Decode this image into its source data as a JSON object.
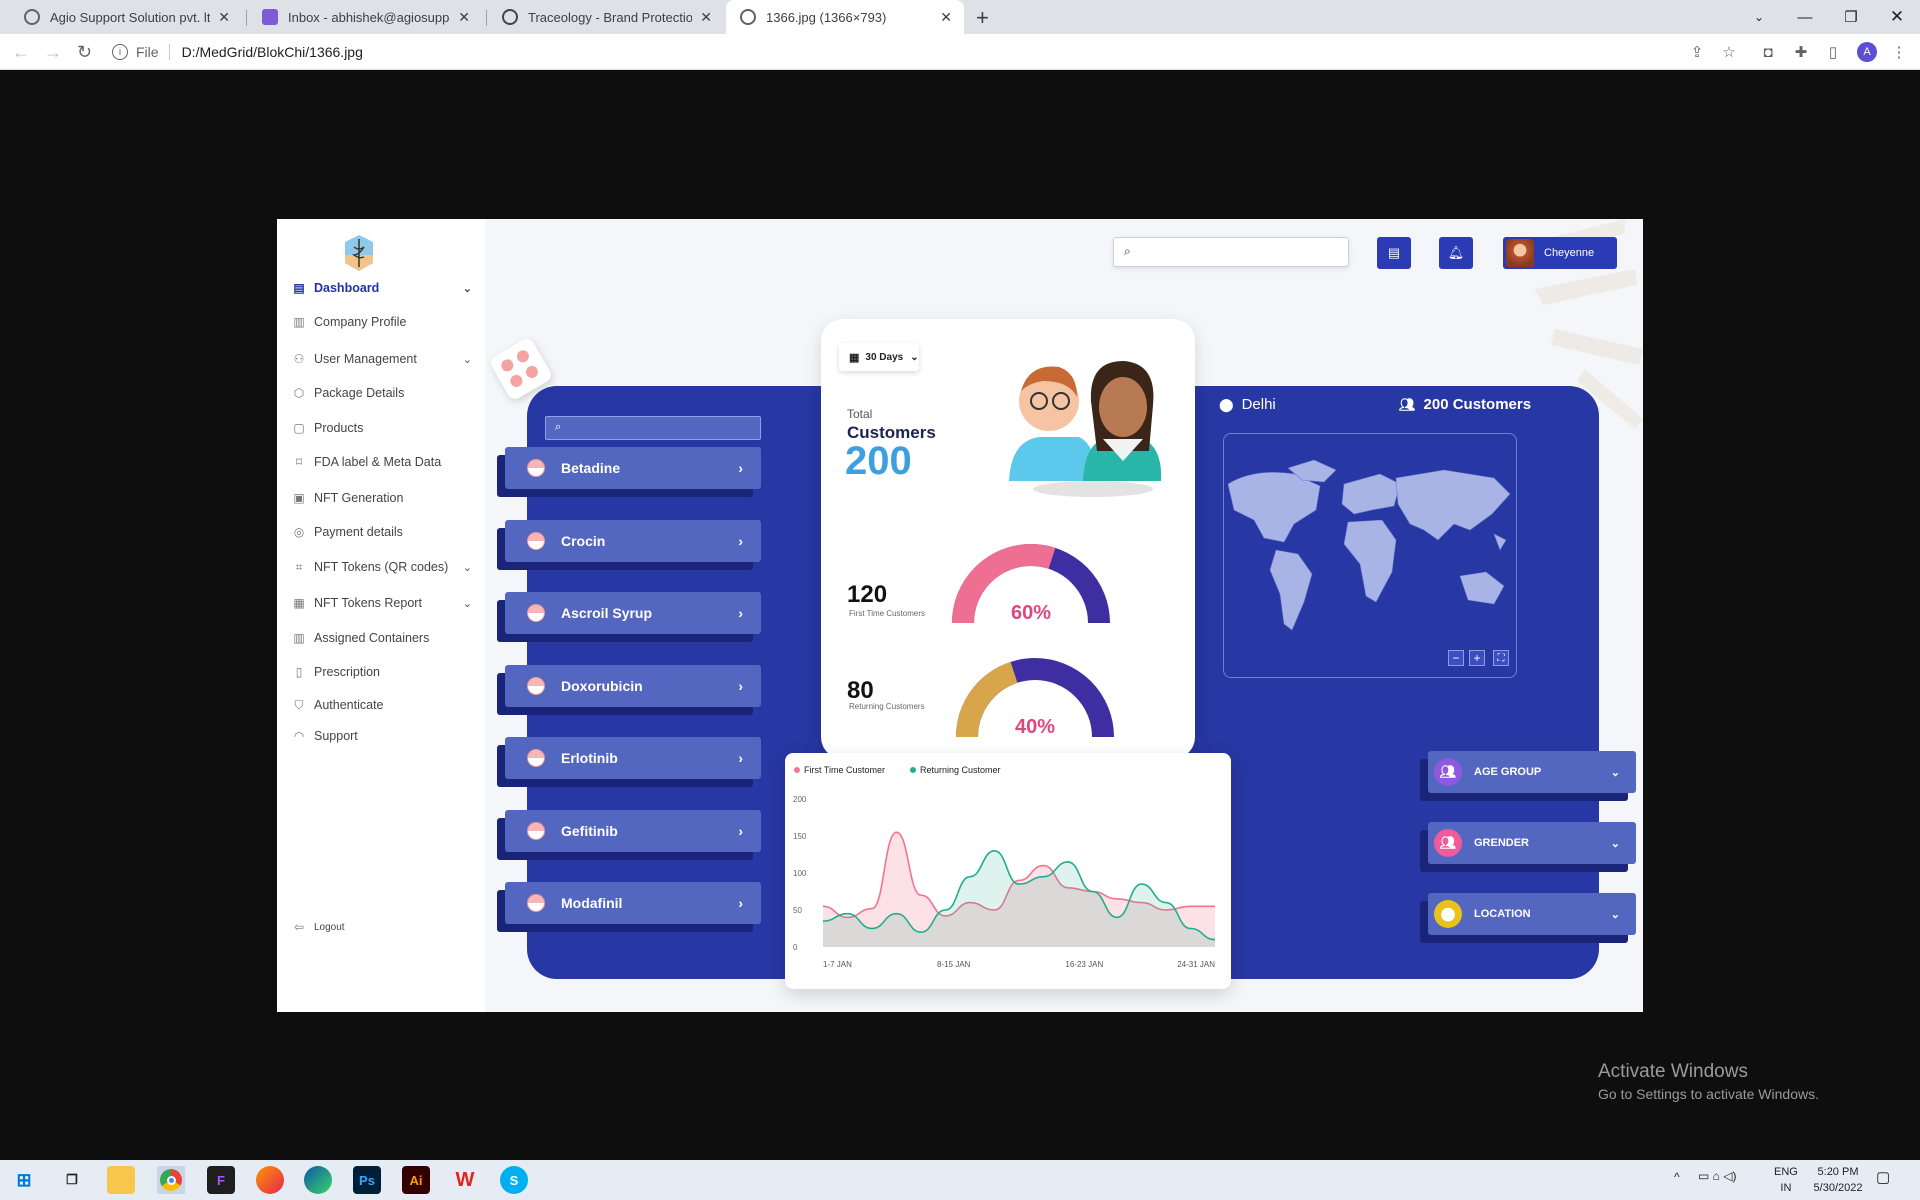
{
  "browser": {
    "tabs": [
      {
        "title": "Agio Support Solution pvt. ltd.",
        "color": "#5f6368"
      },
      {
        "title": "Inbox - abhishek@agiosupport.in",
        "color": "#7b5cd6"
      },
      {
        "title": "Traceology - Brand Protection - D",
        "color": "#444"
      },
      {
        "title": "1366.jpg (1366×793)",
        "color": "#5f6368"
      }
    ],
    "new_tab": "+",
    "url_prefix": "File",
    "url": "D:/MedGrid/BlokChi/1366.jpg",
    "profile_initial": "A"
  },
  "sidebar": {
    "items": [
      {
        "label": "Dashboard",
        "icon": "dashboard-icon",
        "chevron": true,
        "active": true
      },
      {
        "label": "Company Profile",
        "icon": "building-icon",
        "chevron": false
      },
      {
        "label": "User Management",
        "icon": "users-icon",
        "chevron": true
      },
      {
        "label": "Package Details",
        "icon": "box-icon",
        "chevron": false
      },
      {
        "label": "Products",
        "icon": "bag-icon",
        "chevron": false
      },
      {
        "label": "FDA label & Meta Data",
        "icon": "tag-icon",
        "chevron": false
      },
      {
        "label": "NFT Generation",
        "icon": "nft-icon",
        "chevron": false
      },
      {
        "label": "Payment details",
        "icon": "payment-icon",
        "chevron": false
      },
      {
        "label": "NFT Tokens (QR codes)",
        "icon": "qr-icon",
        "chevron": true
      },
      {
        "label": "NFT Tokens Report",
        "icon": "report-icon",
        "chevron": true
      },
      {
        "label": "Assigned Containers",
        "icon": "container-icon",
        "chevron": false
      },
      {
        "label": "Prescription",
        "icon": "prescription-icon",
        "chevron": false
      },
      {
        "label": "Authenticate",
        "icon": "shield-icon",
        "chevron": false
      },
      {
        "label": "Support",
        "icon": "headset-icon",
        "chevron": false
      }
    ],
    "logout": "Logout"
  },
  "header": {
    "user_name": "Cheyenne"
  },
  "drugs": [
    "Betadine",
    "Crocin",
    "Ascroil Syrup",
    "Doxorubicin",
    "Erlotinib",
    "Gefitinib",
    "Modafinil"
  ],
  "summary": {
    "period": "30 Days",
    "total_label": "Total",
    "customers_label": "Customers",
    "total": "200",
    "first_time_value": "120",
    "first_time_label": "First Time Customers",
    "first_time_pct": "60%",
    "first_time_fraction": 0.6,
    "returning_value": "80",
    "returning_label": "Returning Customers",
    "returning_pct": "40%",
    "returning_fraction": 0.4
  },
  "map": {
    "location": "Delhi",
    "customers": "200 Customers",
    "zoom_out": "−",
    "zoom_in": "+"
  },
  "filters": [
    {
      "label": "AGE GROUP",
      "color": "#8f5ae0"
    },
    {
      "label": "GRENDER",
      "color": "#ef5b9c"
    },
    {
      "label": "LOCATION",
      "color": "#e9c31c"
    }
  ],
  "chart_data": {
    "type": "area",
    "title": "",
    "xlabel": "",
    "ylabel": "",
    "ylim": [
      0,
      200
    ],
    "yticks": [
      200,
      150,
      100,
      50,
      0
    ],
    "xticks": [
      "1-7 JAN",
      "8-15 JAN",
      "16-23 JAN",
      "24-31 JAN"
    ],
    "x": [
      0,
      1,
      2,
      3,
      4,
      5,
      6,
      7,
      8,
      9,
      10,
      11,
      12,
      13,
      14,
      15,
      16
    ],
    "series": [
      {
        "name": "First Time Customer",
        "color": "#f2758f",
        "values": [
          55,
          40,
          52,
          155,
          70,
          42,
          60,
          50,
          90,
          110,
          80,
          75,
          65,
          60,
          50,
          55,
          55
        ]
      },
      {
        "name": "Returning Customer",
        "color": "#1fae8e",
        "values": [
          35,
          45,
          25,
          45,
          20,
          50,
          95,
          130,
          85,
          95,
          115,
          75,
          40,
          85,
          60,
          25,
          10
        ]
      }
    ],
    "legend": "top-left",
    "grid": false
  },
  "watermark": {
    "line1": "Activate Windows",
    "line2": "Go to Settings to activate Windows."
  },
  "taskbar": {
    "lang1": "ENG",
    "lang2": "IN",
    "time": "5:20 PM",
    "date": "5/30/2022"
  }
}
